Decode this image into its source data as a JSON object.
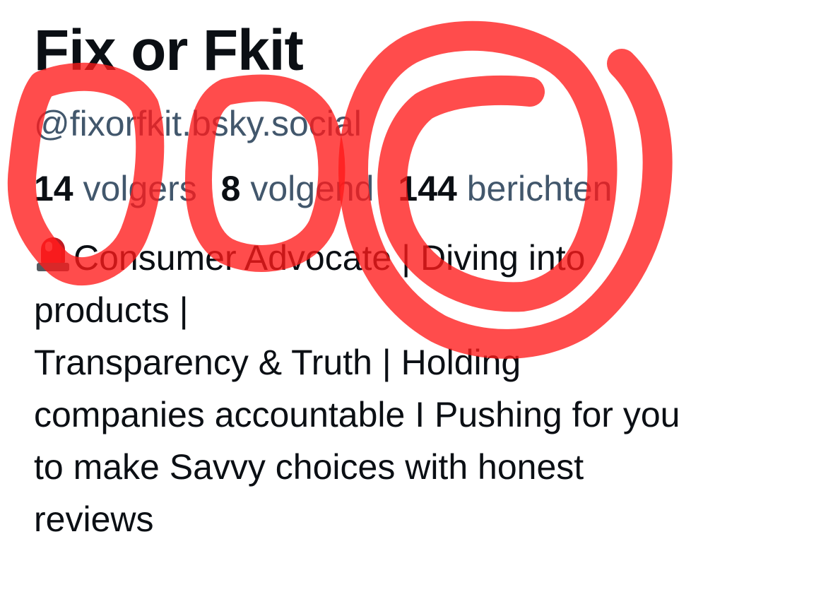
{
  "profile": {
    "display_name": "Fix or Fkit",
    "handle": "@fixorfkit.bsky.social",
    "stats": [
      {
        "count": "14",
        "label": "volgers"
      },
      {
        "count": "8",
        "label": "volgend"
      },
      {
        "count": "144",
        "label": "berichten"
      }
    ],
    "bio": {
      "emoji_icon": "police-siren-icon",
      "lines": [
        "Consumer Advocate | Diving into",
        "products |",
        "Transparency & Truth | Holding",
        "companies accountable I Pushing for you",
        "to make Savvy choices with honest",
        "reviews"
      ]
    }
  },
  "colors": {
    "text_primary": "#0b0f14",
    "text_secondary": "#42576c",
    "annotation_red": "#ff1a1a",
    "siren_red": "#e0202a"
  }
}
